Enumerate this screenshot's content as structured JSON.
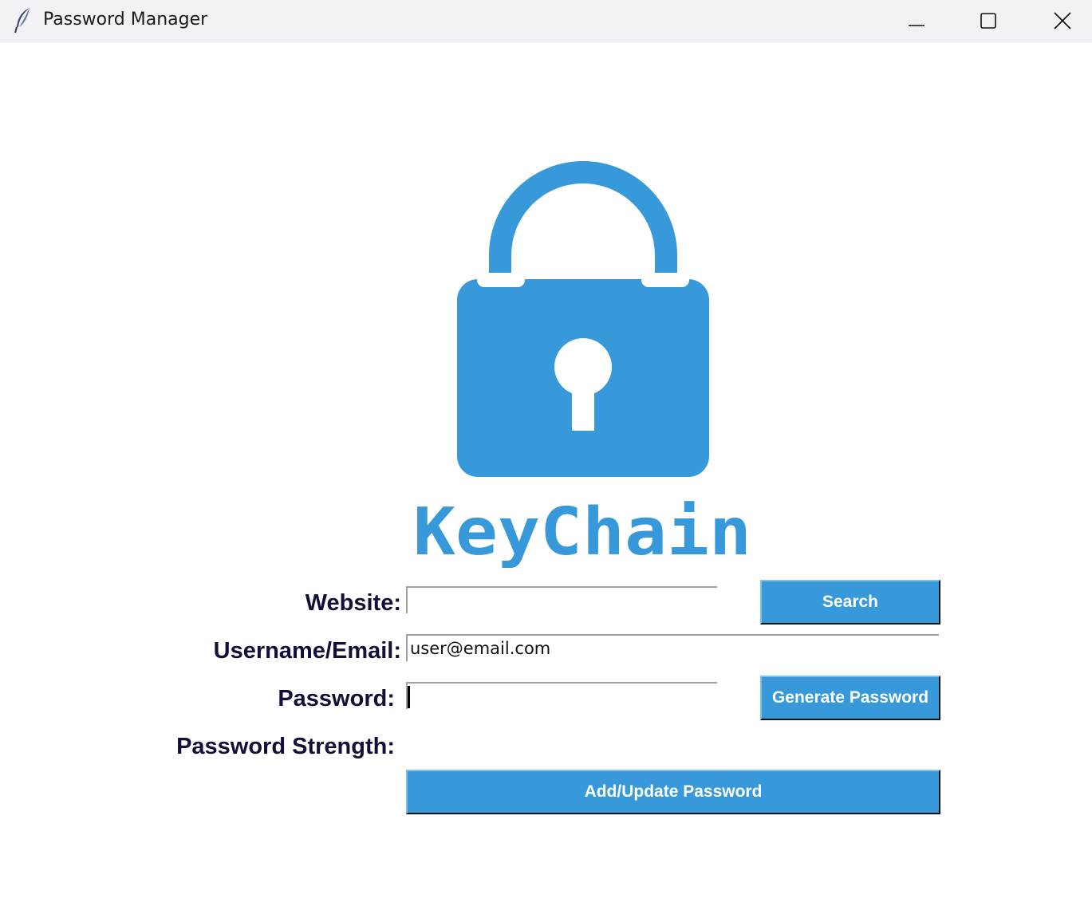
{
  "window": {
    "title": "Password Manager",
    "app_icon": "feather-icon",
    "controls": [
      "minimize-icon",
      "maximize-icon",
      "close-icon"
    ]
  },
  "logo": {
    "icon": "padlock-icon",
    "text": "KeyChain",
    "color": "#3799d9"
  },
  "form": {
    "website_label": "Website:",
    "website_value": "",
    "username_label": "Username/Email:",
    "username_value": "user@email.com",
    "password_label": "Password:",
    "password_value": "",
    "strength_label": "Password Strength:",
    "strength_value": ""
  },
  "buttons": {
    "search": "Search",
    "generate": "Generate Password",
    "add_update": "Add/Update Password"
  },
  "colors": {
    "accent": "#3799d9",
    "label_text": "#10103a",
    "titlebar_bg": "#f2f1f6"
  }
}
